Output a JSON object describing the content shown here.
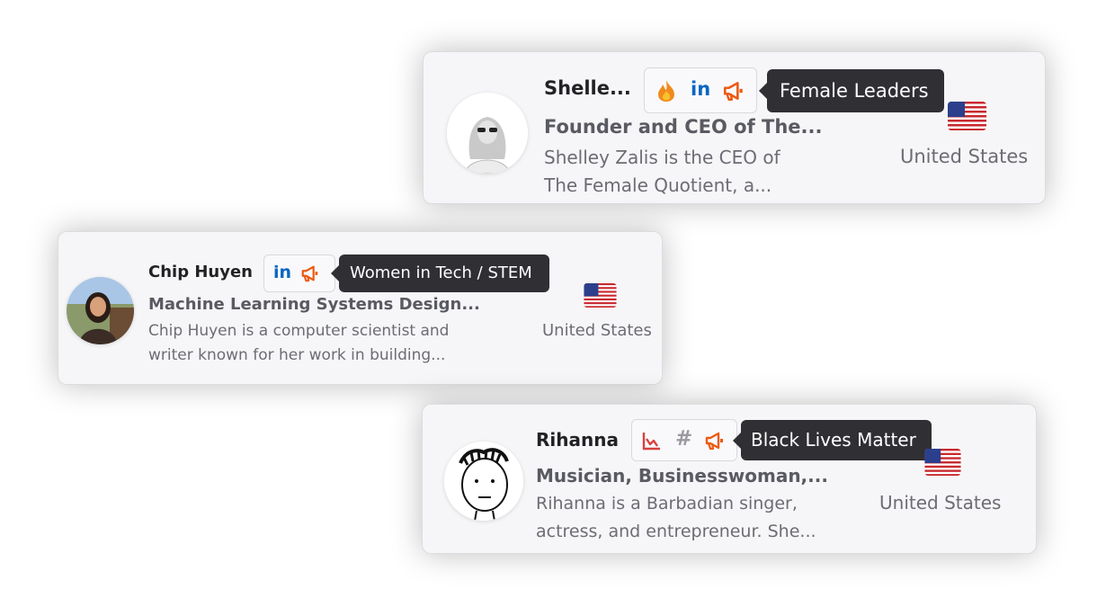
{
  "cards": [
    {
      "name": "Shelle...",
      "title": "Founder and CEO of The...",
      "bio_lines": [
        "Shelley Zalis is the CEO of",
        "The Female Quotient, a..."
      ],
      "country": "United States",
      "tag": "Female Leaders",
      "icons": [
        "fire-icon",
        "linkedin-icon",
        "megaphone-icon"
      ],
      "linkedin_text": "in"
    },
    {
      "name": "Chip Huyen",
      "title": "Machine Learning Systems Design...",
      "bio_lines": [
        "Chip Huyen is a computer scientist and",
        "writer known for her work in building..."
      ],
      "country": "United States",
      "tag": "Women in Tech / STEM",
      "icons": [
        "linkedin-icon",
        "megaphone-icon"
      ],
      "linkedin_text": "in"
    },
    {
      "name": "Rihanna",
      "title": "Musician, Businesswoman,...",
      "bio_lines": [
        "Rihanna is a Barbadian singer,",
        "actress, and entrepreneur. She..."
      ],
      "country": "United States",
      "tag": "Black Lives Matter",
      "icons": [
        "trending-chart-icon",
        "hashtag-icon",
        "megaphone-icon"
      ],
      "hashtag_text": "#"
    }
  ],
  "colors": {
    "fire": "#f08a1c",
    "linkedin": "#0a66c2",
    "megaphone": "#ec5a12",
    "chart": "#d94040",
    "hashtag": "#9a9aa2",
    "tooltip_bg": "#2f2f34",
    "card_bg": "#f6f6f8"
  }
}
